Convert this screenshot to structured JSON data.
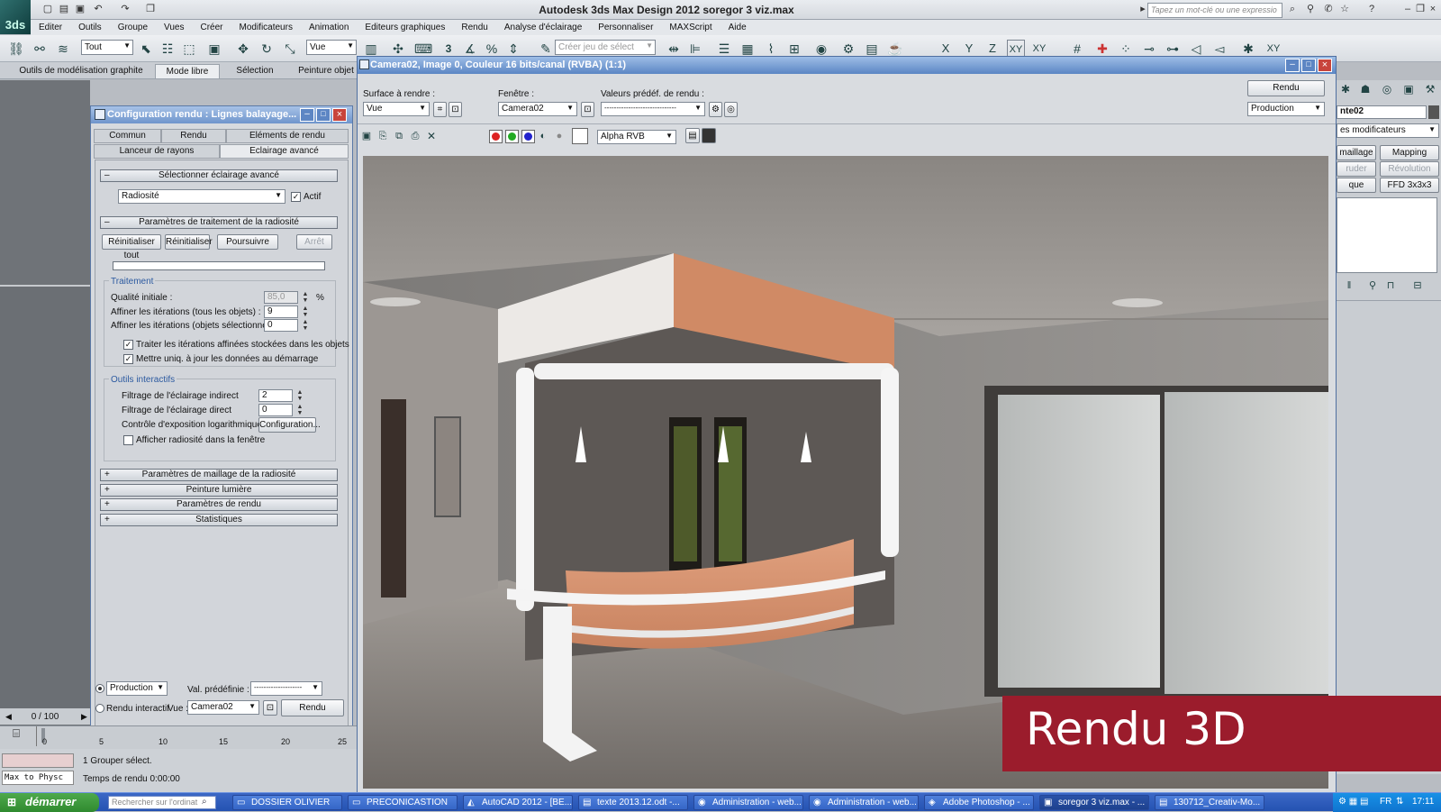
{
  "app": {
    "logo": "3ds",
    "title": "Autodesk 3ds Max Design 2012      soregor 3 viz.max",
    "search_placeholder": "Tapez un mot-clé ou une expressio"
  },
  "menu": [
    "Editer",
    "Outils",
    "Groupe",
    "Vues",
    "Créer",
    "Modificateurs",
    "Animation",
    "Editeurs graphiques",
    "Rendu",
    "Analyse d'éclairage",
    "Personnaliser",
    "MAXScript",
    "Aide"
  ],
  "toolbar": {
    "filter": "Tout",
    "refcoord": "Vue",
    "selset_placeholder": "Créer jeu de sélect",
    "axes": [
      "X",
      "Y",
      "Z",
      "XY",
      "XY"
    ],
    "snap_label": "3"
  },
  "ribbon": {
    "tabs": [
      "Outils de modélisation graphite",
      "Mode libre",
      "Sélection",
      "Peinture objet"
    ],
    "active": 1
  },
  "render_setup": {
    "title": "Configuration rendu : Lignes balayage...",
    "tabs_row1": [
      "Commun",
      "Rendu",
      "Eléments de rendu"
    ],
    "tabs_row2": [
      "Lanceur de rayons",
      "Eclairage avancé"
    ],
    "rollout1": "Sélectionner éclairage avancé",
    "plugin": "Radiosité",
    "actif_label": "Actif",
    "rollout2": "Paramètres de traitement de la radiosité",
    "buttons": [
      "Réinitialiser tout",
      "Réinitialiser",
      "Poursuivre",
      "Arrêt"
    ],
    "traitement": "Traitement",
    "qualite_label": "Qualité initiale :",
    "qualite_value": "85,0",
    "percent": "%",
    "affiner_tous_label": "Affiner les itérations (tous les objets) :",
    "affiner_tous_value": "9",
    "affiner_sel_label": "Affiner les itérations (objets sélectionnés) :",
    "affiner_sel_value": "0",
    "chk_traiter": "Traiter les itérations affinées stockées dans les objets",
    "chk_maj": "Mettre uniq. à jour les données au démarrage",
    "outils": "Outils interactifs",
    "filtre_ind_label": "Filtrage de l'éclairage indirect",
    "filtre_ind_value": "2",
    "filtre_dir_label": "Filtrage de l'éclairage direct",
    "filtre_dir_value": "0",
    "expo_label": "Contrôle d'exposition logarithmique",
    "config_btn": "Configuration...",
    "chk_afficher": "Afficher radiosité dans la fenêtre",
    "collapsed": [
      "Paramètres de maillage de la radiosité",
      "Peinture lumière",
      "Paramètres de rendu",
      "Statistiques"
    ],
    "mode": "Production",
    "preset_label": "Val. prédéfinie :",
    "preset_value": "--------------------",
    "interactive": "Rendu interactif",
    "vue_label": "Vue :",
    "vue_value": "Camera02",
    "render_btn": "Rendu"
  },
  "frame": {
    "title": "Camera02, Image 0, Couleur 16 bits/canal (RVBA) (1:1)",
    "surface_label": "Surface à rendre :",
    "surface_value": "Vue",
    "fenetre_label": "Fenêtre :",
    "fenetre_value": "Camera02",
    "preset_label": "Valeurs prédéf. de rendu :",
    "preset_value": "------------------------------",
    "render_btn": "Rendu",
    "mode": "Production",
    "channel": "Alpha RVB"
  },
  "cmdpanel": {
    "name": "nte02",
    "modlist": "es modificateurs",
    "buttons": [
      "maillage",
      "Mapping UVW",
      "ruder",
      "Révolution",
      "que",
      "FFD 3x3x3"
    ]
  },
  "timeline": {
    "counter": "0 / 100",
    "ticks": [
      "0",
      "5",
      "10",
      "15",
      "20",
      "25"
    ]
  },
  "status": {
    "selection": "1 Grouper sélect.",
    "render_time": "Temps de rendu  0:00:00",
    "script": "Max to Physc"
  },
  "taskbar": {
    "start": "démarrer",
    "search": "Rechercher sur l'ordinat",
    "tasks": [
      "DOSSIER OLIVIER",
      "PRECONICASTION",
      "AutoCAD 2012 - [BE...",
      "texte 2013.12.odt -...",
      "Administration - web...",
      "Administration - web...",
      "Adobe Photoshop - ...",
      "soregor 3 viz.max - ...",
      "130712_Creativ-Mo..."
    ],
    "active": 7,
    "lang": "FR",
    "clock": "17:11"
  },
  "overlay": "Rendu 3D",
  "colors": {
    "overlay_bg": "#9b1c2c",
    "title_blue": "#5b86c4",
    "taskbar": "#2452b2"
  }
}
